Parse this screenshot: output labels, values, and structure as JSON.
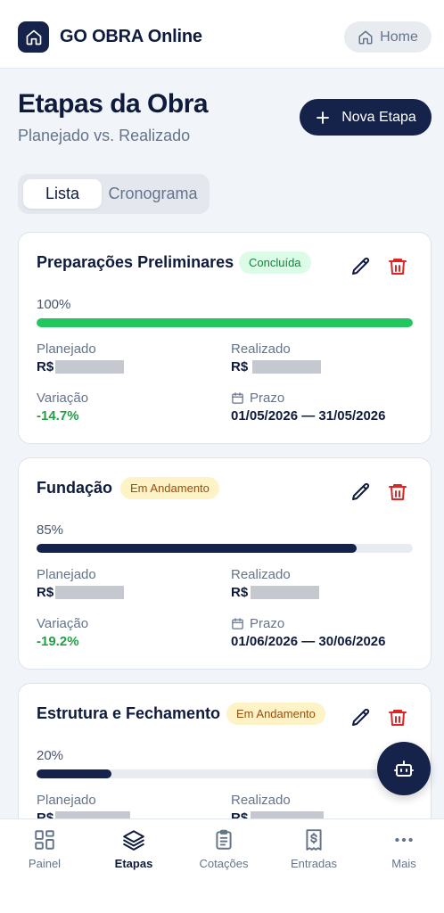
{
  "header": {
    "app_title": "GO OBRA Online",
    "home_label": "Home",
    "icons": {
      "logo": "home-icon",
      "home": "home-icon"
    }
  },
  "page": {
    "title": "Etapas da Obra",
    "subtitle": "Planejado vs. Realizado",
    "new_button": "Nova Etapa"
  },
  "tabs": [
    {
      "label": "Lista",
      "active": true
    },
    {
      "label": "Cronograma",
      "active": false
    }
  ],
  "labels": {
    "planejado": "Planejado",
    "realizado": "Realizado",
    "variacao": "Variação",
    "prazo": "Prazo",
    "currency": "R$"
  },
  "etapas": [
    {
      "name": "Preparações Preliminares",
      "status": "Concluída",
      "status_color": "#16803c",
      "progress_text": "100%",
      "progress": 100,
      "bar_color": "#22c55e",
      "variation": "-14.7%",
      "prazo": "01/05/2026 — 31/05/2026"
    },
    {
      "name": "Fundação",
      "status": "Em Andamento",
      "status_color": "#9a4d0c",
      "progress_text": "85%",
      "progress": 85,
      "bar_color": "#15224a",
      "variation": "-19.2%",
      "prazo": "01/06/2026 — 30/06/2026"
    },
    {
      "name": "Estrutura e Fechamento",
      "status": "Em Andamento",
      "status_color": "#9a4d0c",
      "progress_text": "20%",
      "progress": 20,
      "bar_color": "#15224a"
    }
  ],
  "bottom_nav": [
    {
      "label": "Painel",
      "icon": "grid-icon",
      "active": false
    },
    {
      "label": "Etapas",
      "icon": "layers-icon",
      "active": true
    },
    {
      "label": "Cotações",
      "icon": "clipboard-icon",
      "active": false
    },
    {
      "label": "Entradas",
      "icon": "receipt-dollar-icon",
      "active": false
    },
    {
      "label": "Mais",
      "icon": "more-icon",
      "active": false
    }
  ],
  "colors": {
    "primary": "#15224a",
    "success": "#22c55e",
    "danger": "#dc2626",
    "muted": "#64748b"
  }
}
